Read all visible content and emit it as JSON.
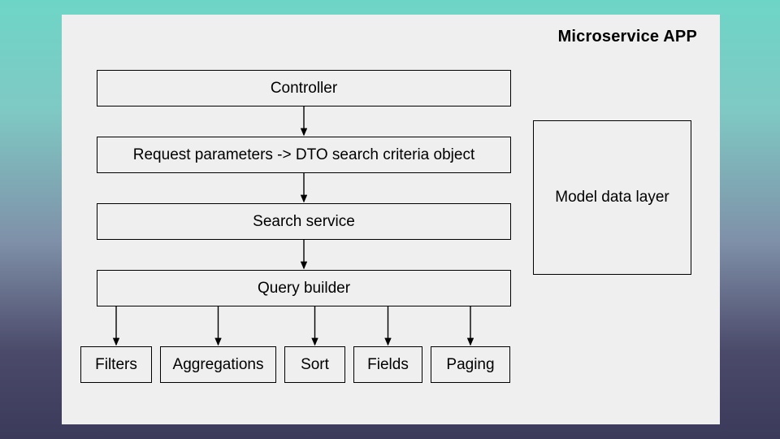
{
  "title": "Microservice APP",
  "boxes": {
    "controller": "Controller",
    "dto": "Request parameters -> DTO search criteria object",
    "search_service": "Search service",
    "query_builder": "Query builder",
    "filters": "Filters",
    "aggregations": "Aggregations",
    "sort": "Sort",
    "fields": "Fields",
    "paging": "Paging",
    "model": "Model data layer"
  }
}
